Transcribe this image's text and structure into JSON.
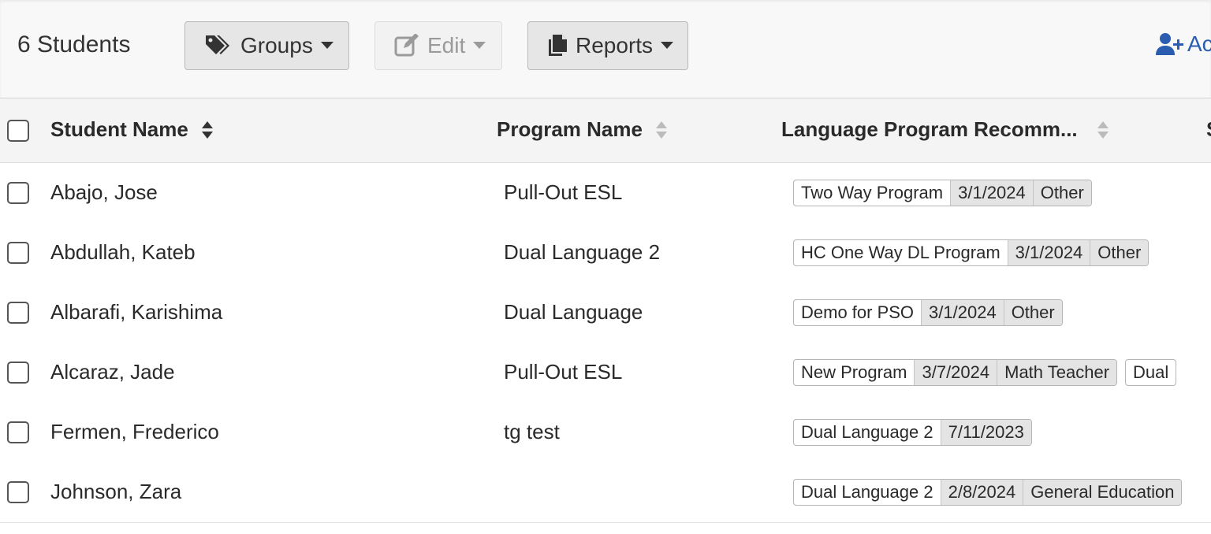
{
  "toolbar": {
    "count": "6 Students",
    "groups_label": "Groups",
    "edit_label": "Edit",
    "reports_label": "Reports",
    "add_label": "Ac"
  },
  "table": {
    "columns": [
      "Student Name",
      "Program Name",
      "Language Program Recomm...",
      "S"
    ],
    "rows": [
      {
        "name": "Abajo, Jose",
        "program": "Pull-Out ESL",
        "recs": [
          [
            "Two Way Program",
            "3/1/2024",
            "Other"
          ]
        ]
      },
      {
        "name": "Abdullah, Kateb",
        "program": "Dual Language 2",
        "recs": [
          [
            "HC One Way DL Program",
            "3/1/2024",
            "Other"
          ]
        ]
      },
      {
        "name": "Albarafi, Karishima",
        "program": "Dual Language",
        "recs": [
          [
            "Demo for PSO",
            "3/1/2024",
            "Other"
          ]
        ]
      },
      {
        "name": "Alcaraz, Jade",
        "program": "Pull-Out ESL",
        "recs": [
          [
            "New Program",
            "3/7/2024",
            "Math Teacher"
          ],
          [
            "Dual"
          ]
        ]
      },
      {
        "name": "Fermen, Frederico",
        "program": "tg test",
        "recs": [
          [
            "Dual Language 2",
            "7/11/2023"
          ]
        ]
      },
      {
        "name": "Johnson, Zara",
        "program": "",
        "recs": [
          [
            "Dual Language 2",
            "2/8/2024",
            "General Education"
          ]
        ]
      }
    ]
  },
  "colors": {
    "link": "#2a5db0",
    "button_bg": "#e6e6e6",
    "header_bg": "#f4f4f4"
  }
}
